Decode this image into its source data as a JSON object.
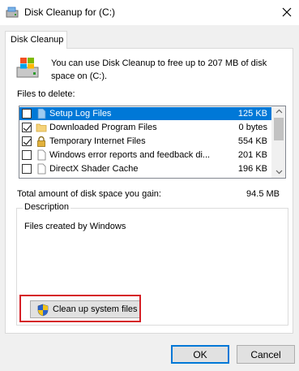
{
  "window": {
    "title": "Disk Cleanup for  (C:)",
    "close_icon": "close-icon"
  },
  "tab": {
    "label": "Disk Cleanup"
  },
  "intro": {
    "text": "You can use Disk Cleanup to free up to 207 MB of disk space on  (C:)."
  },
  "files": {
    "label": "Files to delete:",
    "items": [
      {
        "name": "Setup Log Files",
        "size": "125 KB",
        "checked": false,
        "selected": true,
        "icon": "page-icon"
      },
      {
        "name": "Downloaded Program Files",
        "size": "0 bytes",
        "checked": true,
        "selected": false,
        "icon": "folder-icon"
      },
      {
        "name": "Temporary Internet Files",
        "size": "554 KB",
        "checked": true,
        "selected": false,
        "icon": "lock-icon"
      },
      {
        "name": "Windows error reports and feedback di...",
        "size": "201 KB",
        "checked": false,
        "selected": false,
        "icon": "page-icon"
      },
      {
        "name": "DirectX Shader Cache",
        "size": "196 KB",
        "checked": false,
        "selected": false,
        "icon": "page-icon"
      }
    ]
  },
  "total": {
    "label": "Total amount of disk space you gain:",
    "value": "94.5 MB"
  },
  "description": {
    "legend": "Description",
    "text": "Files created by Windows"
  },
  "buttons": {
    "cleanup_system": "Clean up system files",
    "ok": "OK",
    "cancel": "Cancel"
  },
  "colors": {
    "selection": "#0078d7",
    "highlight_border": "#d51f26",
    "default_button_border": "#0078d7"
  }
}
